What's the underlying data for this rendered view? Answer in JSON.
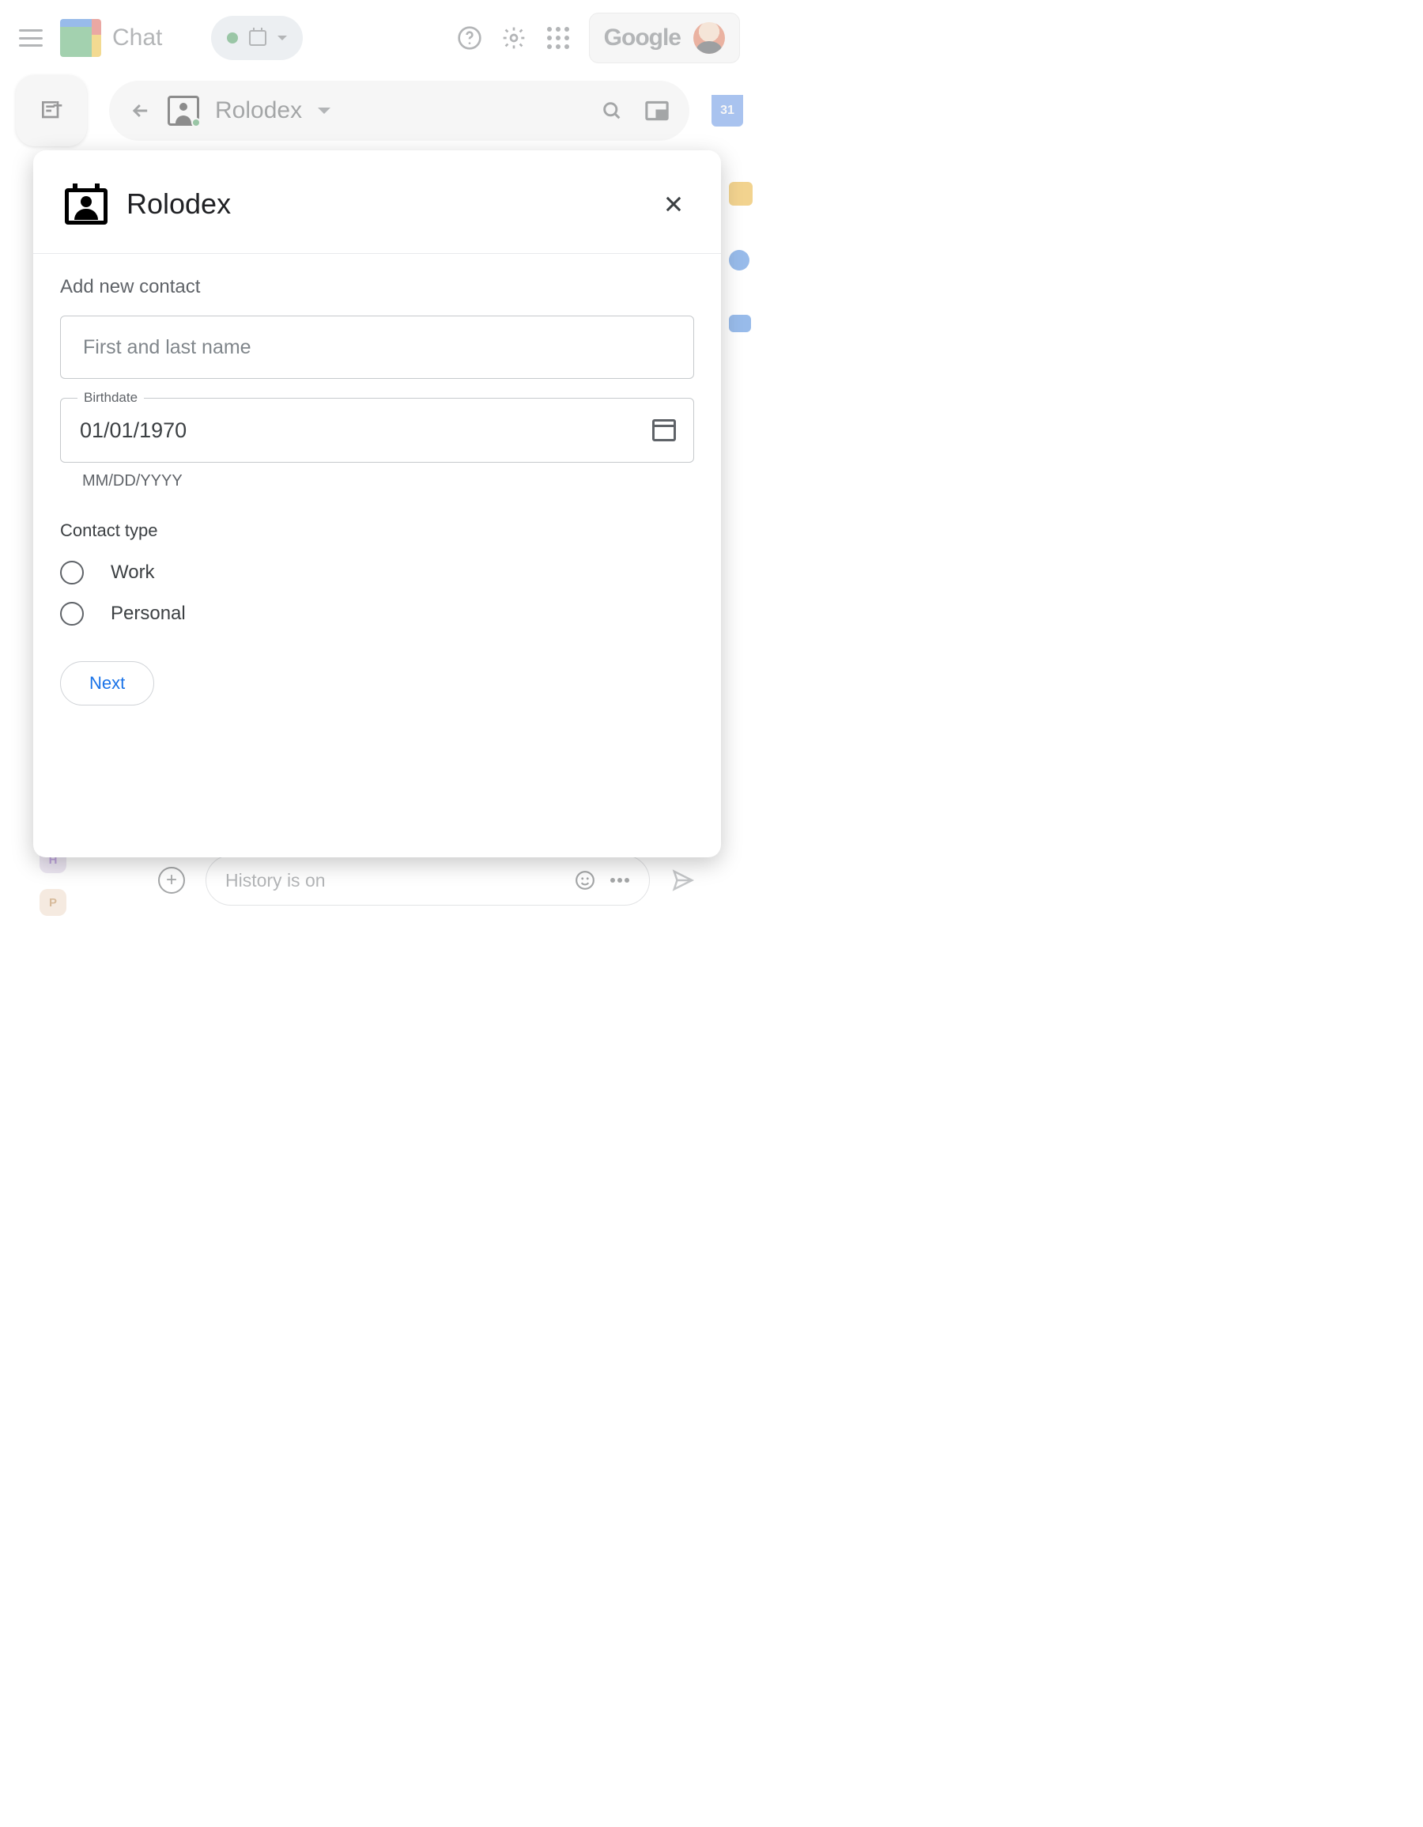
{
  "header": {
    "app_label": "Chat",
    "google_label": "Google"
  },
  "space": {
    "title": "Rolodex",
    "calendar_day": "31"
  },
  "compose": {
    "placeholder": "History is on"
  },
  "sidebar_chips": {
    "h": "H",
    "p": "P"
  },
  "dialog": {
    "title": "Rolodex",
    "section": "Add new contact",
    "name_placeholder": "First and last name",
    "birthdate_label": "Birthdate",
    "birthdate_value": "01/01/1970",
    "birthdate_helper": "MM/DD/YYYY",
    "contact_type_label": "Contact type",
    "options": {
      "work": "Work",
      "personal": "Personal"
    },
    "next": "Next"
  }
}
